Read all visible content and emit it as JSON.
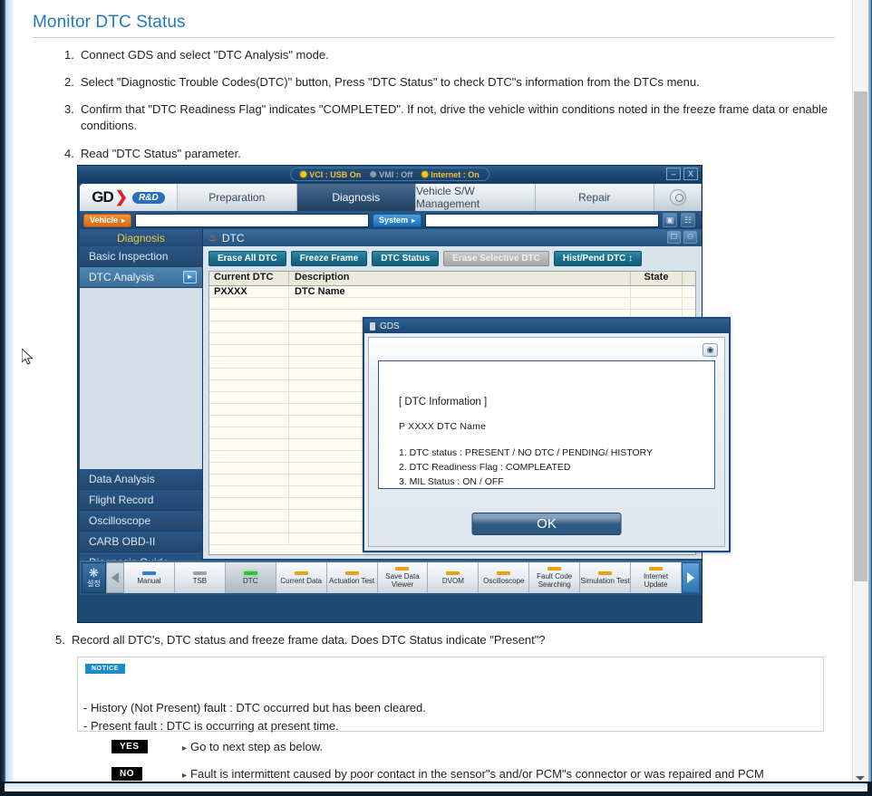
{
  "page": {
    "title": "Monitor DTC Status",
    "title_color": "#1f7bbd",
    "steps": [
      {
        "num": "1.",
        "text": "Connect GDS and select \"DTC Analysis\" mode."
      },
      {
        "num": "2.",
        "text": "Select \"Diagnostic Trouble Codes(DTC)\" button, Press \"DTC Status\" to check DTC\"s information from the DTCs menu."
      },
      {
        "num": "3.",
        "text": "Confirm that \"DTC Readiness Flag\" indicates \"COMPLETED\". If not, drive the vehicle within conditions noted in the freeze frame data or enable conditions."
      },
      {
        "num": "4.",
        "text": "Read \"DTC Status\" parameter."
      },
      {
        "num": "5.",
        "text": "Record all DTC's, DTC status and freeze frame data. Does DTC Status indicate \"Present\"?"
      }
    ]
  },
  "gds": {
    "status": {
      "vci": "VCI : USB On",
      "vmi": "VMI : Off",
      "internet": "Internet : On",
      "on_color": "#f5c518",
      "off_color": "#8d9aa5"
    },
    "window_buttons": {
      "minimize": "–",
      "close": "X"
    },
    "brand": {
      "gd": "GD",
      "swoosh": "❯",
      "rd": "R&D"
    },
    "tabs": [
      {
        "label": "Preparation",
        "active": false
      },
      {
        "label": "Diagnosis",
        "active": true
      },
      {
        "label": "Vehicle S/W Management",
        "active": false
      },
      {
        "label": "Repair",
        "active": false
      }
    ],
    "search_icon": "search-icon",
    "vsbar": {
      "vehicle_label": "Vehicle",
      "system_label": "System",
      "vehicle_value": "",
      "system_value": "",
      "vehicle_placeholder": "",
      "system_placeholder": "",
      "icon1": "camera-icon",
      "icon2": "layout-icon"
    },
    "sidebar": {
      "header": "Diagnosis",
      "top_items": [
        {
          "label": "Basic Inspection",
          "selected": false
        },
        {
          "label": "DTC Analysis",
          "selected": true
        }
      ],
      "bottom_items": [
        {
          "label": "Data Analysis"
        },
        {
          "label": "Flight Record"
        },
        {
          "label": "Oscilloscope"
        },
        {
          "label": "CARB OBD-II"
        },
        {
          "label": "Diagnosis Guide"
        }
      ]
    },
    "panel": {
      "title": "DTC",
      "buttons": [
        {
          "label": "Erase All DTC",
          "disabled": false
        },
        {
          "label": "Freeze Frame",
          "disabled": false
        },
        {
          "label": "DTC Status",
          "disabled": false
        },
        {
          "label": "Erase Selective DTC",
          "disabled": true
        },
        {
          "label": "Hist/Pend DTC ↕",
          "disabled": false
        }
      ],
      "table": {
        "columns": [
          "Current DTC",
          "Description",
          "State"
        ],
        "rows": [
          {
            "dtc": "PXXXX",
            "description": "DTC Name",
            "state": ""
          }
        ]
      }
    },
    "modal": {
      "title": "GDS",
      "camera_icon": "camera-icon",
      "heading": "[ DTC Information ]",
      "code_line": "P XXXX   DTC Name",
      "lines": [
        "1. DTC status : PRESENT / NO DTC / PENDING/ HISTORY",
        "2. DTC Readiness Flag : COMPLEATED",
        "3. MIL Status :  ON / OFF"
      ],
      "ok_label": "OK"
    },
    "taskbar": {
      "settings_label": "설정",
      "prev_icon": "chevron-left-icon",
      "next_icon": "chevron-right-icon",
      "apps": [
        {
          "label": "Manual",
          "chip": "blue",
          "active": false
        },
        {
          "label": "TSB",
          "chip": "grey",
          "active": false
        },
        {
          "label": "DTC",
          "chip": "green",
          "active": true
        },
        {
          "label": "Current Data",
          "chip": "orange",
          "active": false
        },
        {
          "label": "Actuation Test",
          "chip": "orange",
          "active": false
        },
        {
          "label": "Save Data Viewer",
          "chip": "orange",
          "active": false
        },
        {
          "label": "DVOM",
          "chip": "orange",
          "active": false
        },
        {
          "label": "Oscilloscope",
          "chip": "orange",
          "active": false
        },
        {
          "label": "Fault Code Searching",
          "chip": "orange",
          "active": false
        },
        {
          "label": "Simulation Test",
          "chip": "orange",
          "active": false
        },
        {
          "label": "Internet Update",
          "chip": "orange",
          "active": false
        }
      ]
    }
  },
  "notice": {
    "badge": "NOTICE",
    "lines": [
      "- History (Not Present) fault : DTC occurred but has been cleared.",
      "- Present fault : DTC is occurring at present time."
    ]
  },
  "answers": [
    {
      "badge": "YES",
      "text": "Go to next step as below."
    },
    {
      "badge": "NO",
      "text": "Fault is intermittent caused by poor contact in the sensor\"s and/or PCM\"s connector or was repaired and PCM"
    }
  ],
  "scrollbar": {
    "position": "right",
    "thumb_color": "#c0c0c0"
  }
}
